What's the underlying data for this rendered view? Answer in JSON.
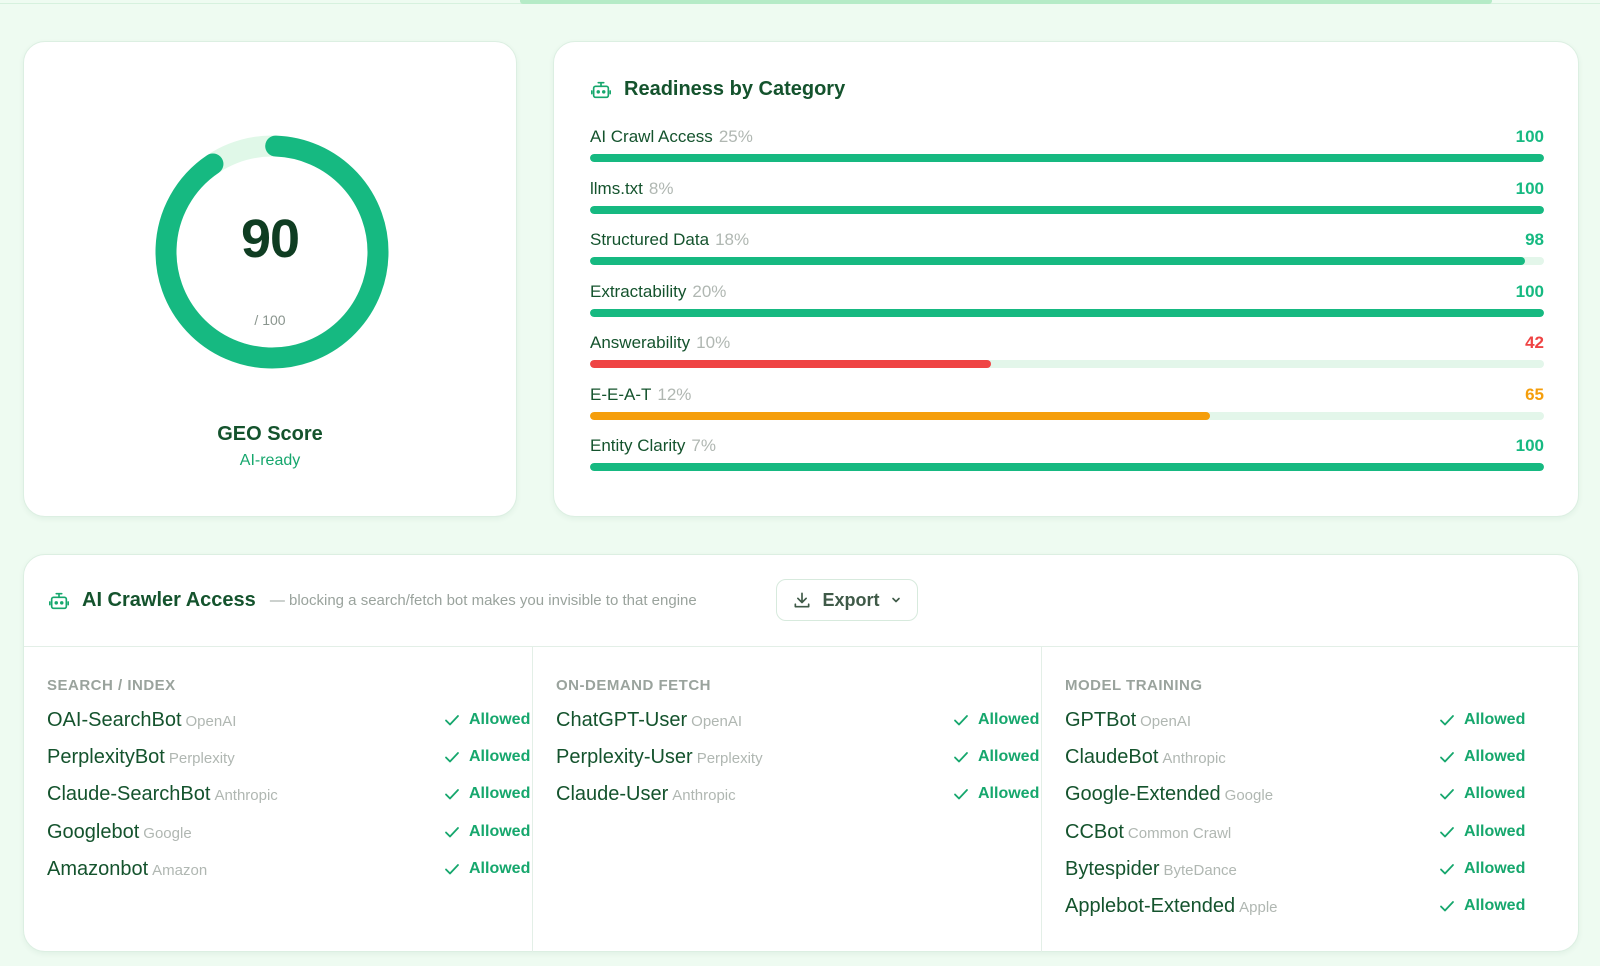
{
  "score": {
    "value": "90",
    "max": "/ 100",
    "percent": 90,
    "label": "GEO Score",
    "status": "AI-ready"
  },
  "readiness": {
    "title": "Readiness by Category",
    "icon": "robot-icon",
    "categories": [
      {
        "name": "AI Crawl Access",
        "weight": "25%",
        "value": "100",
        "percent": 100,
        "color": "#16b981"
      },
      {
        "name": "llms.txt",
        "weight": "8%",
        "value": "100",
        "percent": 100,
        "color": "#16b981"
      },
      {
        "name": "Structured Data",
        "weight": "18%",
        "value": "98",
        "percent": 98,
        "color": "#16b981"
      },
      {
        "name": "Extractability",
        "weight": "20%",
        "value": "100",
        "percent": 100,
        "color": "#16b981"
      },
      {
        "name": "Answerability",
        "weight": "10%",
        "value": "42",
        "percent": 42,
        "color": "#ef4444"
      },
      {
        "name": "E-E-A-T",
        "weight": "12%",
        "value": "65",
        "percent": 65,
        "color": "#f59e0b"
      },
      {
        "name": "Entity Clarity",
        "weight": "7%",
        "value": "100",
        "percent": 100,
        "color": "#16b981"
      }
    ]
  },
  "crawler": {
    "title": "AI Crawler Access",
    "subtitle": "— blocking a search/fetch bot makes you invisible to that engine",
    "export_label": "Export",
    "icon": "robot-icon",
    "columns": [
      {
        "heading": "SEARCH / INDEX",
        "bots": [
          {
            "name": "OAI-SearchBot",
            "vendor": "OpenAI",
            "status": "Allowed"
          },
          {
            "name": "PerplexityBot",
            "vendor": "Perplexity",
            "status": "Allowed"
          },
          {
            "name": "Claude-SearchBot",
            "vendor": "Anthropic",
            "status": "Allowed"
          },
          {
            "name": "Googlebot",
            "vendor": "Google",
            "status": "Allowed"
          },
          {
            "name": "Amazonbot",
            "vendor": "Amazon",
            "status": "Allowed"
          }
        ]
      },
      {
        "heading": "ON-DEMAND FETCH",
        "bots": [
          {
            "name": "ChatGPT-User",
            "vendor": "OpenAI",
            "status": "Allowed"
          },
          {
            "name": "Perplexity-User",
            "vendor": "Perplexity",
            "status": "Allowed"
          },
          {
            "name": "Claude-User",
            "vendor": "Anthropic",
            "status": "Allowed"
          }
        ]
      },
      {
        "heading": "MODEL TRAINING",
        "bots": [
          {
            "name": "GPTBot",
            "vendor": "OpenAI",
            "status": "Allowed"
          },
          {
            "name": "ClaudeBot",
            "vendor": "Anthropic",
            "status": "Allowed"
          },
          {
            "name": "Google-Extended",
            "vendor": "Google",
            "status": "Allowed"
          },
          {
            "name": "CCBot",
            "vendor": "Common Crawl",
            "status": "Allowed"
          },
          {
            "name": "Bytespider",
            "vendor": "ByteDance",
            "status": "Allowed"
          },
          {
            "name": "Applebot-Extended",
            "vendor": "Apple",
            "status": "Allowed"
          }
        ]
      }
    ]
  },
  "colors": {
    "accent": "#16b981",
    "warning": "#f59e0b",
    "danger": "#ef4444",
    "track": "#e3f6ea",
    "heading": "#14532d"
  }
}
